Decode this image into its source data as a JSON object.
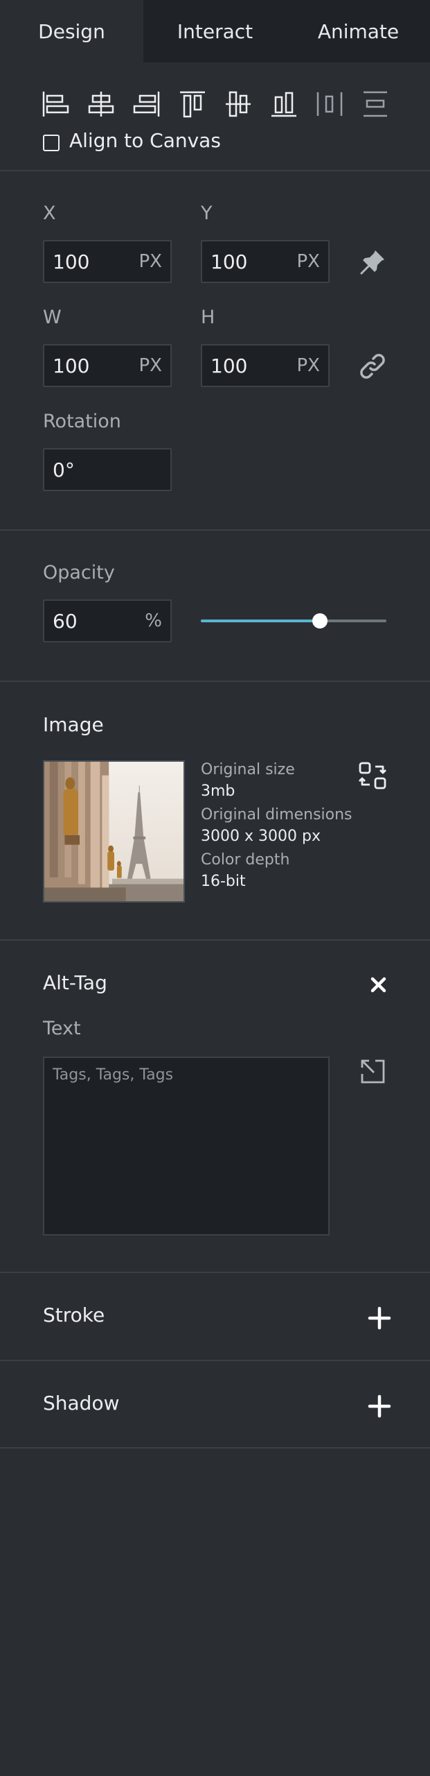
{
  "tabs": [
    {
      "label": "Design"
    },
    {
      "label": "Interact"
    },
    {
      "label": "Animate"
    }
  ],
  "toolbar": {
    "icons": [
      "align-left-icon",
      "align-horizontal-center-icon",
      "align-right-icon",
      "align-top-icon",
      "align-vertical-center-icon",
      "align-bottom-icon",
      "distribute-horizontal-icon",
      "distribute-vertical-icon"
    ],
    "align_to_canvas_label": "Align to Canvas",
    "align_to_canvas_checked": false
  },
  "transform": {
    "x_label": "X",
    "x_value": "100",
    "x_unit": "PX",
    "y_label": "Y",
    "y_value": "100",
    "y_unit": "PX",
    "w_label": "W",
    "w_value": "100",
    "w_unit": "PX",
    "h_label": "H",
    "h_value": "100",
    "h_unit": "PX",
    "rotation_label": "Rotation",
    "rotation_value": "0°"
  },
  "opacity": {
    "label": "Opacity",
    "value": "60",
    "unit": "%",
    "slider_fraction": 0.64
  },
  "image": {
    "title": "Image",
    "original_size_label": "Original size",
    "original_size_value": "3mb",
    "dimensions_label": "Original dimensions",
    "dimensions_value": "3000 x 3000 px",
    "color_depth_label": "Color depth",
    "color_depth_value": "16-bit"
  },
  "alt_tag": {
    "title": "Alt-Tag",
    "text_label": "Text",
    "placeholder": "Tags, Tags, Tags"
  },
  "stroke": {
    "title": "Stroke"
  },
  "shadow": {
    "title": "Shadow"
  },
  "colors": {
    "panel_bg": "#2a2e33",
    "tab_inactive_bg": "#1f2327",
    "input_bg": "#1d2024",
    "accent": "#5ab5cf"
  }
}
